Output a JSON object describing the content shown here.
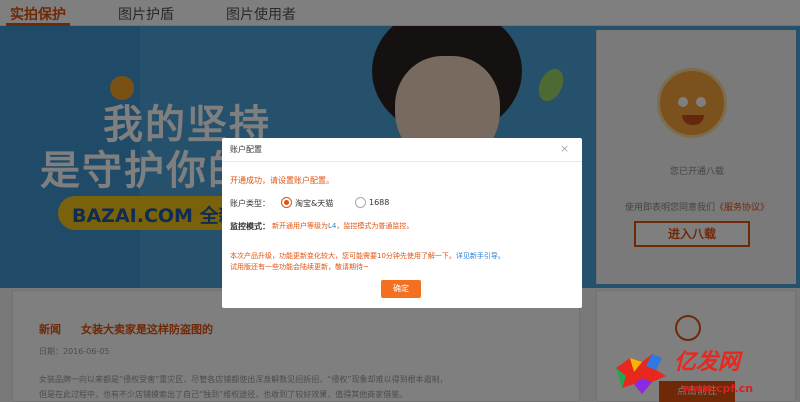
{
  "nav": {
    "tabs": [
      {
        "label": "实拍保护",
        "active": true
      },
      {
        "label": "图片护盾",
        "active": false
      },
      {
        "label": "图片使用者",
        "active": false
      }
    ]
  },
  "banner": {
    "slogan_line1": "我的坚持",
    "slogan_line2": "是守护你的",
    "site": "BAZAI.COM 全新"
  },
  "side_panel": {
    "opened_text": "您已开通八载",
    "agreement_prefix": "使用即表明您同意我们",
    "agreement_link": "《服务协议》",
    "enter_button": "进入八载"
  },
  "news": {
    "label": "新闻",
    "title": "女装大卖家是这样防盗图的",
    "date": "日期：2016-06-05",
    "para_line1": "女装品牌一向以来都是“侵权受害”重灾区，尽管各店铺都使出浑身解数见招拆招，“侵权”现象却难以得到根本遏制，",
    "para_line2": "但是在此过程中，也有不少店铺摸索出了自己“独到”维权途径，也收到了较好效果，值得其他商家借鉴。"
  },
  "side_lower": {
    "button": "点击前往"
  },
  "modal": {
    "title": "账户配置",
    "close": "×",
    "success_msg": "开通成功，请设置账户配置。",
    "account_type_label": "账户类型：",
    "options": [
      {
        "label": "淘宝&天猫",
        "selected": true
      },
      {
        "label": "1688",
        "selected": false
      }
    ],
    "mode_label": "监控模式：",
    "mode_text_pre": "新开通用户等级为",
    "mode_level": "L4",
    "mode_text_post": "，监控模式为普通监控。",
    "notice_line1_pre": "本次产品升级，功能更新变化较大，您可能需要10分钟先使用了解一下。",
    "notice_link": "详见新手引导。",
    "notice_line2": "试用版还有一些功能会陆续更新，敬请期待~",
    "confirm_button": "确定"
  },
  "watermark": {
    "brand": "亿发网",
    "url": "www.cpf.cn"
  },
  "colors": {
    "accent": "#e0520f",
    "banner_blue": "#4aa3da",
    "link_blue": "#2a7fd4",
    "button_orange": "#f37021"
  }
}
